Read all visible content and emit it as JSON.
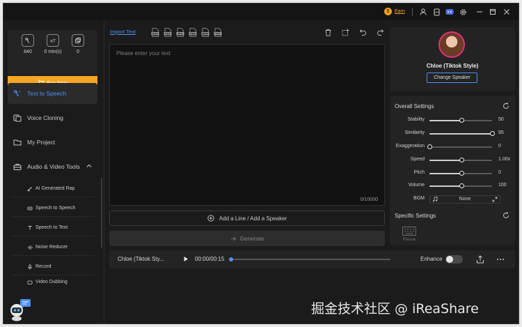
{
  "titlebar": {
    "earn_label": "Earn"
  },
  "sidebar": {
    "stats": [
      {
        "icon": "characters-icon",
        "value": "840"
      },
      {
        "icon": "minutes-icon",
        "value": "0 min(s)"
      },
      {
        "icon": "voices-icon",
        "value": "0"
      }
    ],
    "buy_label": "Buy Now",
    "nav": [
      {
        "label": "Text to Speech",
        "icon": "text-to-speech-icon",
        "active": true
      },
      {
        "label": "Voice Cloning",
        "icon": "voice-cloning-icon"
      },
      {
        "label": "My Project",
        "icon": "folder-icon"
      },
      {
        "label": "Audio & Video Tools",
        "icon": "toolbox-icon"
      }
    ],
    "tools": [
      {
        "label": "AI Generated Rap"
      },
      {
        "label": "Speech to Speech"
      },
      {
        "label": "Speech to Text"
      },
      {
        "label": "Noise Reducer"
      },
      {
        "label": "Record"
      },
      {
        "label": "Video Dubbing"
      }
    ]
  },
  "editor": {
    "import_label": "Import Text",
    "formats": [
      "DOC",
      "PDF",
      "JPG",
      "PNG",
      "BMP",
      "TXT"
    ],
    "placeholder": "Please enter your text",
    "counter": "0/10000",
    "add_line_label": "Add a Line / Add a Speaker",
    "generate_label": "Generate"
  },
  "speaker": {
    "name": "Chloe (Tiktok Style)",
    "change_label": "Change Speaker"
  },
  "settings": {
    "overall_title": "Overall Settings",
    "sliders": [
      {
        "label": "Stability",
        "value": "50",
        "fraction": 0.52
      },
      {
        "label": "Similarity",
        "value": "95",
        "fraction": 1.0
      },
      {
        "label": "Exaggeration",
        "value": "0",
        "fraction": 0.0
      },
      {
        "label": "Speed",
        "value": "1.00x",
        "fraction": 0.52
      },
      {
        "label": "Pitch",
        "value": "0",
        "fraction": 0.52
      },
      {
        "label": "Volume",
        "value": "100",
        "fraction": 0.52
      }
    ],
    "bgm_label": "BGM",
    "bgm_value": "None",
    "specific_title": "Specific Settings",
    "pause_label": "Pause"
  },
  "player": {
    "name": "Chloe (Tiktok Sty...",
    "time": "00:00/00:15",
    "progress": 0.0,
    "enhance_label": "Enhance"
  },
  "watermark": "掘金技术社区 @ iReaShare",
  "colors": {
    "accent": "#4f8ff7",
    "buy": "#f5a623",
    "earn": "#f0a31a"
  }
}
